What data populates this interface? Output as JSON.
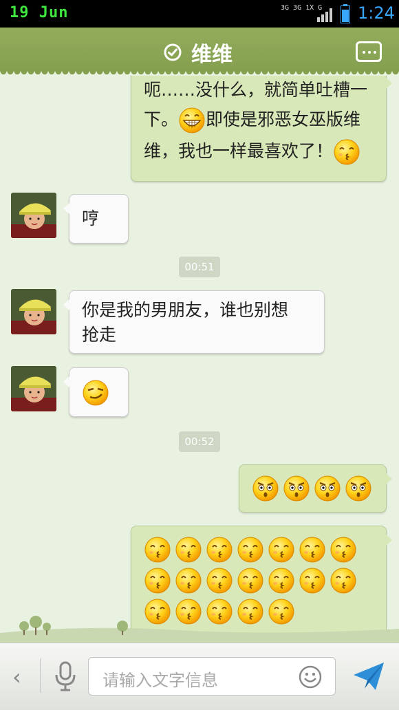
{
  "status_bar": {
    "date": "19 Jun",
    "network": "3G 3G 1X G",
    "time": "1:24"
  },
  "header": {
    "title": "维维",
    "status_icon": "check-circle-icon",
    "menu_icon": "chat-menu-icon"
  },
  "messages": [
    {
      "id": "m1",
      "direction": "out",
      "lines": [
        "呃……没什么，就简单吐槽一",
        "下。",
        "即使是邪恶女巫版维",
        "维，我也一样最喜欢了！"
      ],
      "emojis": [
        "grin-emoji",
        "kiss-emoji"
      ]
    },
    {
      "id": "m2",
      "direction": "in",
      "text": "哼"
    },
    {
      "id": "t1",
      "type": "timestamp",
      "text": "00:51"
    },
    {
      "id": "m3",
      "direction": "in",
      "lines": [
        "你是我的男朋友，谁也别想",
        "抢走"
      ]
    },
    {
      "id": "m4",
      "direction": "in",
      "emojis": [
        "smirk-emoji"
      ]
    },
    {
      "id": "t2",
      "type": "timestamp",
      "text": "00:52"
    },
    {
      "id": "m5",
      "direction": "out",
      "emojis": [
        "angry-emoji",
        "angry-emoji",
        "angry-emoji",
        "angry-emoji"
      ]
    },
    {
      "id": "m6",
      "direction": "out",
      "emoji_count": 19,
      "emojis": [
        "kiss-emoji"
      ]
    }
  ],
  "input_bar": {
    "placeholder": "请输入文字信息",
    "back_label": "‹"
  },
  "colors": {
    "header": "#8aa656",
    "out_bubble": "#d8e8b8",
    "in_bubble": "#fafafa",
    "time_accent": "#3aa7ff",
    "send": "#2e8fd8"
  }
}
